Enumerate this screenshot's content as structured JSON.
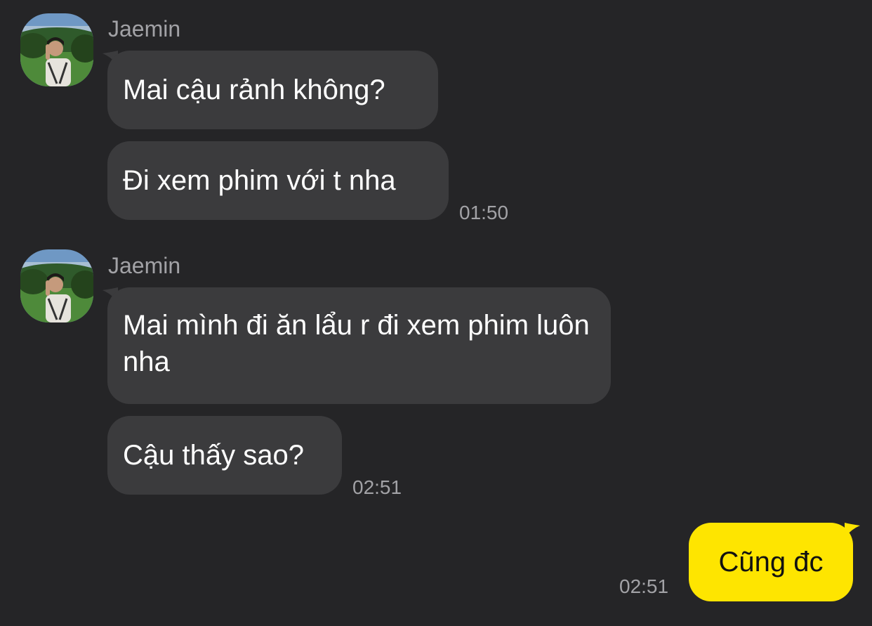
{
  "conversation": {
    "group1": {
      "sender": "Jaemin",
      "messages": [
        "Mai cậu rảnh không?",
        "Đi xem phim với t nha"
      ],
      "time": "01:50"
    },
    "group2": {
      "sender": "Jaemin",
      "messages": [
        "Mai mình đi ăn lẩu r đi xem phim luôn nha",
        "Cậu thấy sao?"
      ],
      "time": "02:51"
    },
    "outgoing": {
      "message": "Cũng đc",
      "time": "02:51"
    }
  },
  "colors": {
    "background": "#252527",
    "incoming_bubble": "#3b3b3d",
    "outgoing_bubble": "#fee500",
    "meta_text": "#a2a2a6"
  }
}
